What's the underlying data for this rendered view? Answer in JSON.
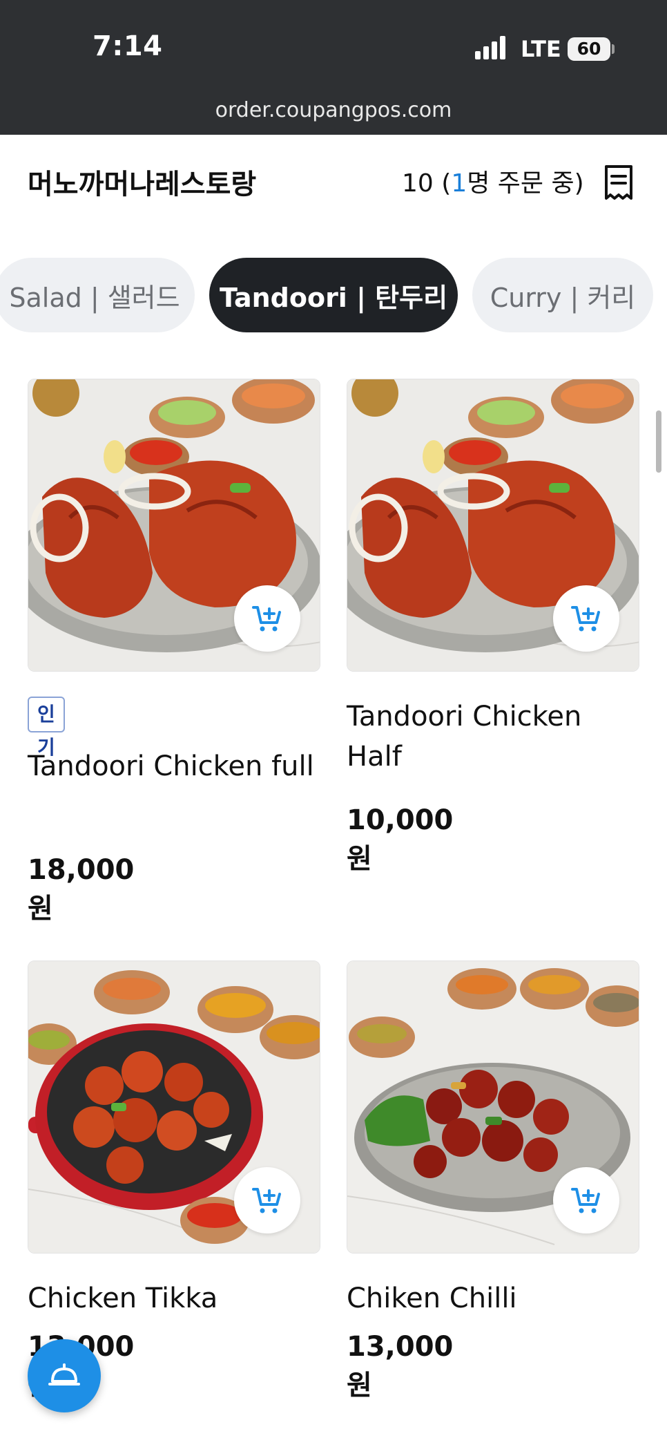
{
  "status_bar": {
    "time": "7:14",
    "network": "LTE",
    "battery": "60",
    "url": "order.coupangpos.com"
  },
  "header": {
    "store_name": "머노까머나레스토랑",
    "table_number": "10",
    "ordering_prefix": " (",
    "ordering_count": "1",
    "ordering_suffix": "명 주문 중)"
  },
  "tabs": [
    {
      "label": "Salad | 샐러드",
      "active": false
    },
    {
      "label": "Tandoori | 탄두리",
      "active": true
    },
    {
      "label": "Curry | 커리",
      "active": false
    }
  ],
  "products": [
    {
      "name": "Tandoori Chicken full",
      "price": "18,000원",
      "badge": "인기"
    },
    {
      "name": "Tandoori Chicken Half",
      "price": "10,000원",
      "badge": ""
    },
    {
      "name": "Chicken Tikka",
      "price": "13,000원",
      "badge": ""
    },
    {
      "name": "Chiken Chilli",
      "price": "13,000원",
      "badge": ""
    }
  ],
  "colors": {
    "accent": "#1e8fe6",
    "active_tab": "#1f2226",
    "status_bar": "#2e3033"
  },
  "icons": {
    "cart": "cart-plus-icon",
    "receipt": "receipt-icon",
    "fab": "service-bell-icon"
  }
}
